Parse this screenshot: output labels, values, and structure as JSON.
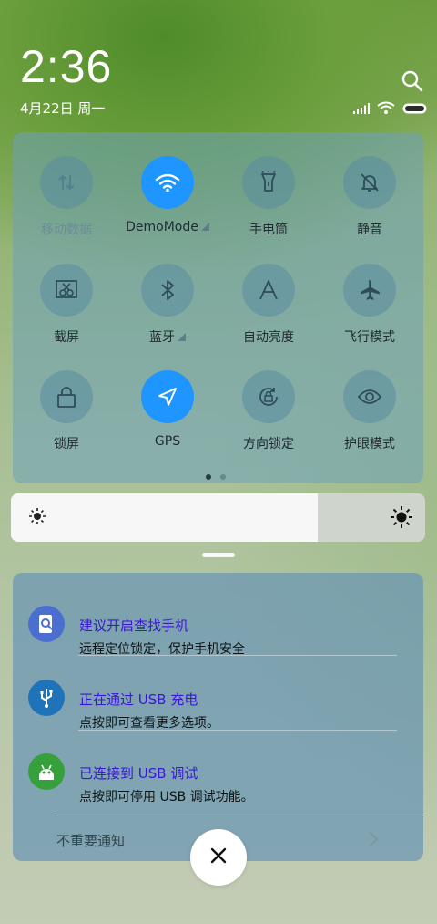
{
  "status": {
    "time": "2:36",
    "date": "4月22日 周一"
  },
  "quick_settings": {
    "page_count": 2,
    "active_page": 1,
    "tiles": [
      {
        "label": "移动数据",
        "icon": "mobile-data-icon",
        "active": false,
        "dim": true
      },
      {
        "label": "DemoMode",
        "icon": "wifi-icon",
        "active": true,
        "has_menu": true
      },
      {
        "label": "手电筒",
        "icon": "flashlight-icon",
        "active": false
      },
      {
        "label": "静音",
        "icon": "bell-mute-icon",
        "active": false
      },
      {
        "label": "截屏",
        "icon": "screenshot-icon",
        "active": false
      },
      {
        "label": "蓝牙",
        "icon": "bluetooth-icon",
        "active": false,
        "has_menu": true
      },
      {
        "label": "自动亮度",
        "icon": "auto-brightness-icon",
        "active": false
      },
      {
        "label": "飞行模式",
        "icon": "airplane-icon",
        "active": false
      },
      {
        "label": "锁屏",
        "icon": "lock-icon",
        "active": false
      },
      {
        "label": "GPS",
        "icon": "gps-icon",
        "active": true
      },
      {
        "label": "方向锁定",
        "icon": "rotation-lock-icon",
        "active": false
      },
      {
        "label": "护眼模式",
        "icon": "eye-icon",
        "active": false
      }
    ]
  },
  "brightness": {
    "level": 0.74
  },
  "notifications": [
    {
      "title": "建议开启查找手机",
      "subtitle": "远程定位锁定，保护手机安全",
      "icon": "find-phone-icon",
      "icon_bg": "#4a6fd0"
    },
    {
      "title": "正在通过 USB 充电",
      "subtitle": "点按即可查看更多选项。",
      "icon": "usb-icon",
      "icon_bg": "#1f73b8"
    },
    {
      "title": "已连接到 USB 调试",
      "subtitle": "点按即可停用 USB 调试功能。",
      "icon": "android-debug-icon",
      "icon_bg": "#36a03c"
    }
  ],
  "unimportant": {
    "label": "不重要通知"
  },
  "colors": {
    "accent": "#1e95ff",
    "notif_title": "#3a16d8"
  }
}
